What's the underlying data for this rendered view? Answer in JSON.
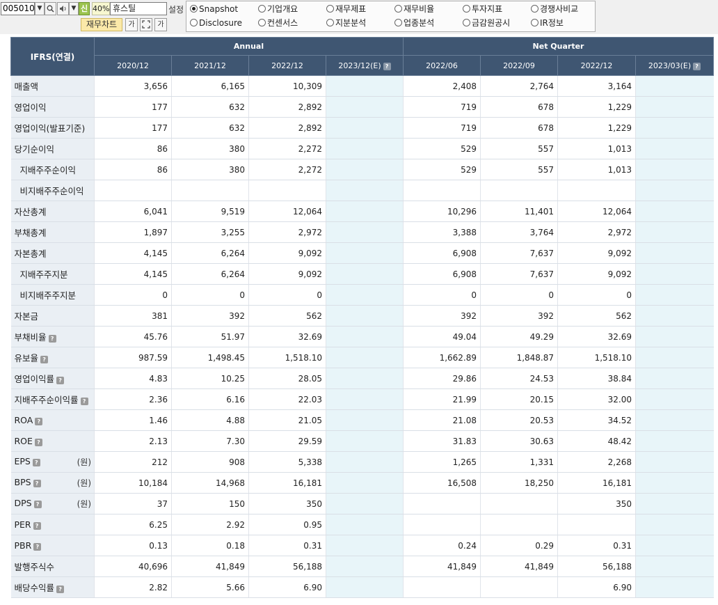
{
  "toolbar": {
    "stock_code": "005010",
    "dropdown_icon": "chevron-down-icon",
    "search_icon": "search-icon",
    "sound_icon": "speaker-icon",
    "new_badge": "신",
    "ratio": "40%",
    "stock_name": "휴스틸",
    "settings_label": "설정",
    "fin_chart_label": "재무차트",
    "font_btn_1": "가",
    "font_btn_3": "가"
  },
  "tabs": [
    {
      "label": "Snapshot",
      "selected": true
    },
    {
      "label": "기업개요",
      "selected": false
    },
    {
      "label": "재무제표",
      "selected": false
    },
    {
      "label": "재무비율",
      "selected": false
    },
    {
      "label": "투자지표",
      "selected": false
    },
    {
      "label": "경쟁사비교",
      "selected": false
    },
    {
      "label": "Disclosure",
      "selected": false
    },
    {
      "label": "컨센서스",
      "selected": false
    },
    {
      "label": "지분분석",
      "selected": false
    },
    {
      "label": "업종분석",
      "selected": false
    },
    {
      "label": "금감원공시",
      "selected": false
    },
    {
      "label": "IR정보",
      "selected": false
    }
  ],
  "table": {
    "corner_label": "IFRS(연결)",
    "group_annual": "Annual",
    "group_quarter": "Net Quarter",
    "columns": [
      "2020/12",
      "2021/12",
      "2022/12",
      "2023/12(E)",
      "2022/06",
      "2022/09",
      "2022/12",
      "2023/03(E)"
    ],
    "estimate_cols": [
      3,
      7
    ],
    "rows": [
      {
        "label": "매출액",
        "indent": false,
        "q": false,
        "unit": "",
        "values": [
          "3,656",
          "6,165",
          "10,309",
          "",
          "2,408",
          "2,764",
          "3,164",
          ""
        ]
      },
      {
        "label": "영업이익",
        "indent": false,
        "q": false,
        "unit": "",
        "values": [
          "177",
          "632",
          "2,892",
          "",
          "719",
          "678",
          "1,229",
          ""
        ]
      },
      {
        "label": "영업이익(발표기준)",
        "indent": false,
        "q": false,
        "unit": "",
        "values": [
          "177",
          "632",
          "2,892",
          "",
          "719",
          "678",
          "1,229",
          ""
        ]
      },
      {
        "label": "당기순이익",
        "indent": false,
        "q": false,
        "unit": "",
        "values": [
          "86",
          "380",
          "2,272",
          "",
          "529",
          "557",
          "1,013",
          ""
        ]
      },
      {
        "label": "지배주주순이익",
        "indent": true,
        "q": false,
        "unit": "",
        "values": [
          "86",
          "380",
          "2,272",
          "",
          "529",
          "557",
          "1,013",
          ""
        ]
      },
      {
        "label": "비지배주주순이익",
        "indent": true,
        "q": false,
        "unit": "",
        "values": [
          "",
          "",
          "",
          "",
          "",
          "",
          "",
          ""
        ]
      },
      {
        "label": "자산총계",
        "indent": false,
        "q": false,
        "unit": "",
        "values": [
          "6,041",
          "9,519",
          "12,064",
          "",
          "10,296",
          "11,401",
          "12,064",
          ""
        ]
      },
      {
        "label": "부채총계",
        "indent": false,
        "q": false,
        "unit": "",
        "values": [
          "1,897",
          "3,255",
          "2,972",
          "",
          "3,388",
          "3,764",
          "2,972",
          ""
        ]
      },
      {
        "label": "자본총계",
        "indent": false,
        "q": false,
        "unit": "",
        "values": [
          "4,145",
          "6,264",
          "9,092",
          "",
          "6,908",
          "7,637",
          "9,092",
          ""
        ]
      },
      {
        "label": "지배주주지분",
        "indent": true,
        "q": false,
        "unit": "",
        "values": [
          "4,145",
          "6,264",
          "9,092",
          "",
          "6,908",
          "7,637",
          "9,092",
          ""
        ]
      },
      {
        "label": "비지배주주지분",
        "indent": true,
        "q": false,
        "unit": "",
        "values": [
          "0",
          "0",
          "0",
          "",
          "0",
          "0",
          "0",
          ""
        ]
      },
      {
        "label": "자본금",
        "indent": false,
        "q": false,
        "unit": "",
        "values": [
          "381",
          "392",
          "562",
          "",
          "392",
          "392",
          "562",
          ""
        ]
      },
      {
        "label": "부채비율",
        "indent": false,
        "q": true,
        "unit": "",
        "values": [
          "45.76",
          "51.97",
          "32.69",
          "",
          "49.04",
          "49.29",
          "32.69",
          ""
        ]
      },
      {
        "label": "유보율",
        "indent": false,
        "q": true,
        "unit": "",
        "values": [
          "987.59",
          "1,498.45",
          "1,518.10",
          "",
          "1,662.89",
          "1,848.87",
          "1,518.10",
          ""
        ]
      },
      {
        "label": "영업이익률",
        "indent": false,
        "q": true,
        "unit": "",
        "values": [
          "4.83",
          "10.25",
          "28.05",
          "",
          "29.86",
          "24.53",
          "38.84",
          ""
        ]
      },
      {
        "label": "지배주주순이익률",
        "indent": false,
        "q": true,
        "unit": "",
        "values": [
          "2.36",
          "6.16",
          "22.03",
          "",
          "21.99",
          "20.15",
          "32.00",
          ""
        ]
      },
      {
        "label": "ROA",
        "indent": false,
        "q": true,
        "unit": "",
        "values": [
          "1.46",
          "4.88",
          "21.05",
          "",
          "21.08",
          "20.53",
          "34.52",
          ""
        ]
      },
      {
        "label": "ROE",
        "indent": false,
        "q": true,
        "unit": "",
        "values": [
          "2.13",
          "7.30",
          "29.59",
          "",
          "31.83",
          "30.63",
          "48.42",
          ""
        ]
      },
      {
        "label": "EPS",
        "indent": false,
        "q": true,
        "unit": "(원)",
        "values": [
          "212",
          "908",
          "5,338",
          "",
          "1,265",
          "1,331",
          "2,268",
          ""
        ]
      },
      {
        "label": "BPS",
        "indent": false,
        "q": true,
        "unit": "(원)",
        "values": [
          "10,184",
          "14,968",
          "16,181",
          "",
          "16,508",
          "18,250",
          "16,181",
          ""
        ]
      },
      {
        "label": "DPS",
        "indent": false,
        "q": true,
        "unit": "(원)",
        "values": [
          "37",
          "150",
          "350",
          "",
          "",
          "",
          "350",
          ""
        ]
      },
      {
        "label": "PER",
        "indent": false,
        "q": true,
        "unit": "",
        "values": [
          "6.25",
          "2.92",
          "0.95",
          "",
          "",
          "",
          "",
          ""
        ]
      },
      {
        "label": "PBR",
        "indent": false,
        "q": true,
        "unit": "",
        "values": [
          "0.13",
          "0.18",
          "0.31",
          "",
          "0.24",
          "0.29",
          "0.31",
          ""
        ]
      },
      {
        "label": "발행주식수",
        "indent": false,
        "q": false,
        "unit": "",
        "values": [
          "40,696",
          "41,849",
          "56,188",
          "",
          "41,849",
          "41,849",
          "56,188",
          ""
        ]
      },
      {
        "label": "배당수익률",
        "indent": false,
        "q": true,
        "unit": "",
        "values": [
          "2.82",
          "5.66",
          "6.90",
          "",
          "",
          "",
          "6.90",
          ""
        ]
      }
    ]
  },
  "colors": {
    "header_bg": "#3f5672",
    "label_bg": "#eaeff4",
    "estimate_bg": "#e8f5f9",
    "fin_chart_bg": "#fbe9a9",
    "new_badge_bg": "#9bc34e"
  }
}
